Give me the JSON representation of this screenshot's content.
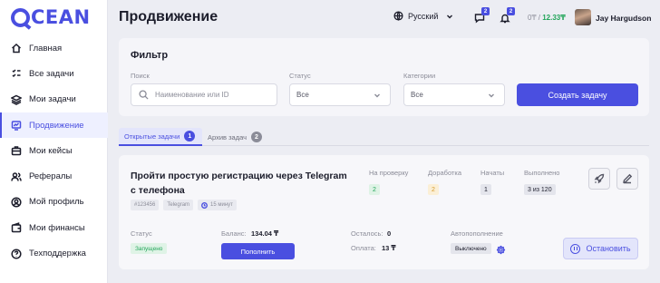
{
  "app": {
    "logo_text": "CEAN",
    "logo_full": "OCEAN"
  },
  "sidebar": {
    "items": [
      {
        "label": "Главная",
        "icon": "home-icon"
      },
      {
        "label": "Все задачи",
        "icon": "tasks-icon"
      },
      {
        "label": "Мои задачи",
        "icon": "layers-icon"
      },
      {
        "label": "Продвижение",
        "icon": "promotion-icon",
        "active": true
      },
      {
        "label": "Мои кейсы",
        "icon": "briefcase-icon"
      },
      {
        "label": "Рефералы",
        "icon": "referrals-icon"
      },
      {
        "label": "Мой профиль",
        "icon": "profile-icon"
      },
      {
        "label": "Мои финансы",
        "icon": "wallet-icon"
      },
      {
        "label": "Техподдержка",
        "icon": "help-icon"
      }
    ]
  },
  "header": {
    "title": "Продвижение",
    "language": "Русский",
    "messages_count": "2",
    "notifications_count": "2",
    "balance_prefix": "0₸ / ",
    "balance_value": "12.33₸",
    "user_name": "Jay Hargudson"
  },
  "filter": {
    "title": "Фильтр",
    "search_label": "Поиск",
    "search_placeholder": "Наименование или ID",
    "status_label": "Статус",
    "status_value": "Все",
    "category_label": "Категории",
    "category_value": "Все",
    "create_button": "Создать задачу"
  },
  "tabs": [
    {
      "label": "Открытые задачи",
      "count": "1",
      "active": true
    },
    {
      "label": "Архив задач",
      "count": "2",
      "active": false
    }
  ],
  "task": {
    "title": "Пройти простую регистрацию через Telegram с телефона",
    "tags": {
      "id": "#123456",
      "platform": "Telegram",
      "duration": "15 минут"
    },
    "stats": [
      {
        "label": "На проверку",
        "value": "2",
        "color": "#23a55a",
        "bg": "#dff3e6"
      },
      {
        "label": "Доработка",
        "value": "2",
        "color": "#d69a2a",
        "bg": "#fbefd6"
      },
      {
        "label": "Начаты",
        "value": "1",
        "color": "#1c1d2b",
        "bg": "#e4e5ec"
      },
      {
        "label": "Выполнено",
        "value": "3 из 120",
        "color": "#1c1d2b",
        "bg": "#e4e5ec"
      }
    ],
    "status_label": "Статус",
    "status_value": "Запущено",
    "balance_label": "Баланс:",
    "balance_value": "134.04 ₸",
    "topup_button": "Пополнить",
    "remaining_label": "Осталось:",
    "remaining_value": "0",
    "payment_label": "Оплата:",
    "payment_value": "13 ₸",
    "autopay_label": "Автопополнение",
    "autopay_value": "Выключено",
    "stop_button": "Остановить"
  },
  "colors": {
    "accent": "#4a4fe0",
    "success": "#23a55a",
    "warning": "#d69a2a"
  }
}
